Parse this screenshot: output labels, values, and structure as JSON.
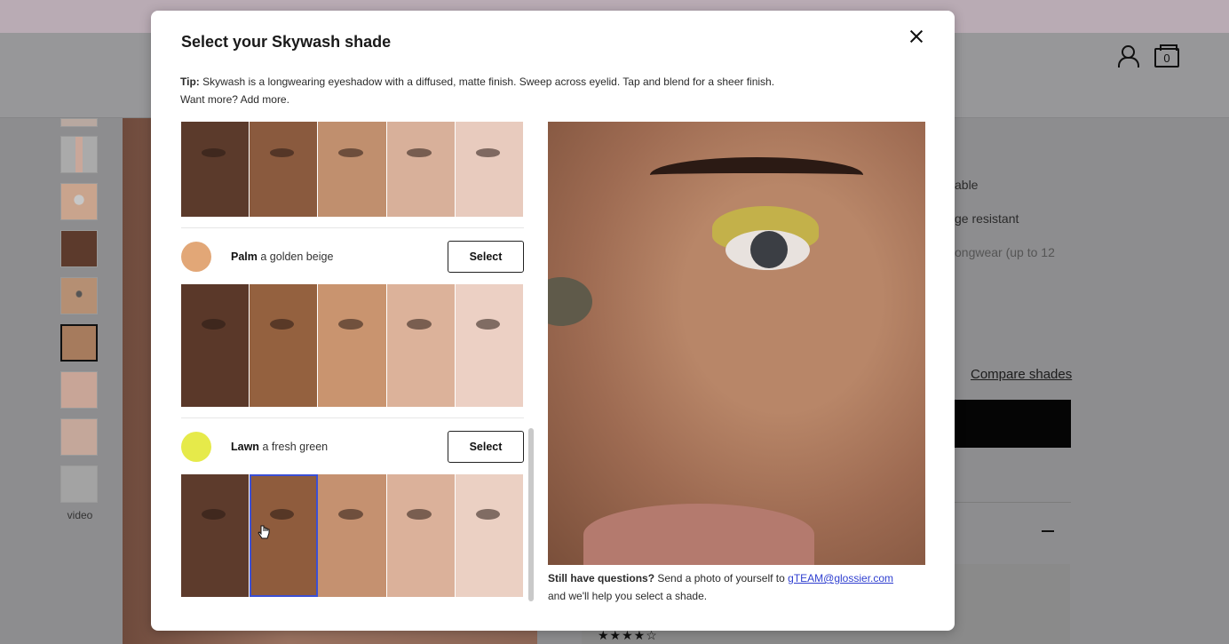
{
  "background": {
    "thumb_label": "video",
    "right_texts": [
      "able",
      "ge resistant",
      "ongwear (up to 12"
    ],
    "compare_shades": "Compare shades",
    "cart_count": "0",
    "stars": "★★★★☆"
  },
  "modal": {
    "title": "Select your Skywash shade",
    "tip_label": "Tip:",
    "tip_text": "Skywash is a longwearing eyeshadow with a diffused, matte finish. Sweep across eyelid. Tap and blend for a sheer finish. Want more? Add more.",
    "shades": [
      {
        "name": "Palm",
        "desc": "a golden beige",
        "swatch": "#e2a777",
        "select_label": "Select"
      },
      {
        "name": "Lawn",
        "desc": "a fresh green",
        "swatch": "#e6ea4a",
        "select_label": "Select"
      }
    ],
    "questions_bold": "Still have questions?",
    "questions_text": "Send a photo of yourself to",
    "questions_email": "gTEAM@glossier.com",
    "questions_tail": "and we'll help you select a shade."
  },
  "icons": {
    "close": "close-icon",
    "user": "user-icon",
    "bag": "bag-icon",
    "cursor": "hand-cursor-icon"
  }
}
